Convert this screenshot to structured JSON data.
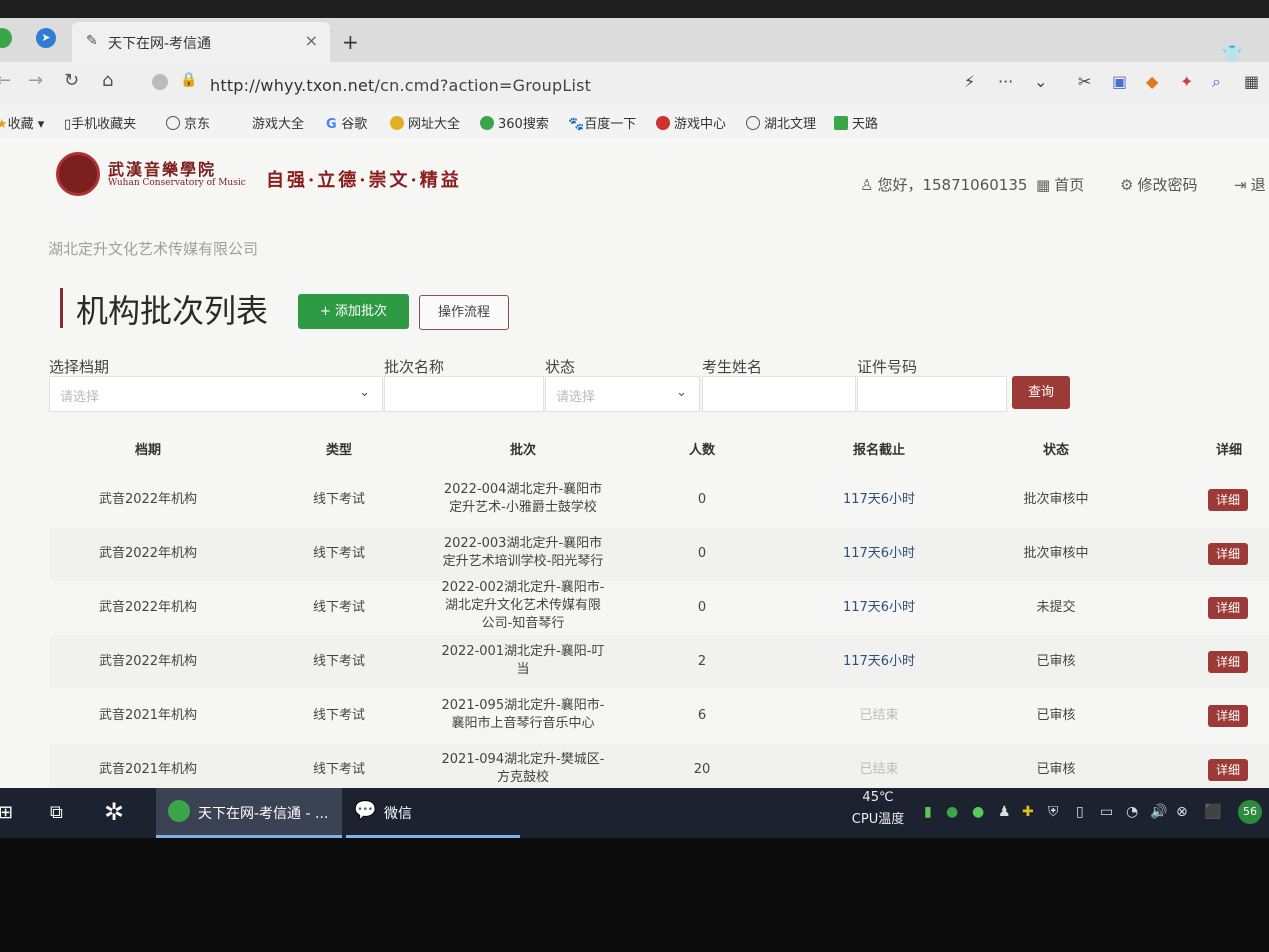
{
  "browser": {
    "tab_title": "天下在网-考信通",
    "tab_close": "×",
    "new_tab": "+",
    "url_host": "http://whyy.txon.net",
    "url_path": "/cn.cmd?action=GroupList",
    "bookmarks": [
      "收藏",
      "手机收藏夹",
      "京东",
      "游戏大全",
      "谷歌",
      "网址大全",
      "360搜索",
      "百度一下",
      "游戏中心",
      "湖北文理",
      "天路"
    ]
  },
  "header": {
    "logo_cn": "武漢音樂學院",
    "logo_en": "Wuhan Conservatory of Music",
    "motto": "自强·立德·崇文·精益",
    "greeting": "您好，15871060135",
    "home": "首页",
    "change_password": "修改密码",
    "logout": "退"
  },
  "page": {
    "company": "湖北定升文化艺术传媒有限公司",
    "title": "机构批次列表",
    "add_button": "+ 添加批次",
    "flow_button": "操作流程"
  },
  "filters": {
    "period_label": "选择档期",
    "period_placeholder": "请选择",
    "batch_label": "批次名称",
    "status_label": "状态",
    "status_placeholder": "请选择",
    "student_label": "考生姓名",
    "id_label": "证件号码",
    "query_button": "查询"
  },
  "table": {
    "headers": [
      "档期",
      "类型",
      "批次",
      "人数",
      "报名截止",
      "状态",
      "详细"
    ],
    "rows": [
      {
        "period": "武音2022年机构",
        "type": "线下考试",
        "batch1": "2022-004湖北定升-襄阳市",
        "batch2": "定升艺术-小雅爵士鼓学校",
        "batch3": "",
        "count": "0",
        "due": "117天6小时",
        "status": "批次审核中",
        "detail": "详细"
      },
      {
        "period": "武音2022年机构",
        "type": "线下考试",
        "batch1": "2022-003湖北定升-襄阳市",
        "batch2": "定升艺术培训学校-阳光琴行",
        "batch3": "",
        "count": "0",
        "due": "117天6小时",
        "status": "批次审核中",
        "detail": "详细"
      },
      {
        "period": "武音2022年机构",
        "type": "线下考试",
        "batch1": "2022-002湖北定升-襄阳市-",
        "batch2": "湖北定升文化艺术传媒有限",
        "batch3": "公司-知音琴行",
        "count": "0",
        "due": "117天6小时",
        "status": "未提交",
        "detail": "详细"
      },
      {
        "period": "武音2022年机构",
        "type": "线下考试",
        "batch1": "2022-001湖北定升-襄阳-叮",
        "batch2": "当",
        "batch3": "",
        "count": "2",
        "due": "117天6小时",
        "status": "已审核",
        "detail": "详细"
      },
      {
        "period": "武音2021年机构",
        "type": "线下考试",
        "batch1": "2021-095湖北定升-襄阳市-",
        "batch2": "襄阳市上音琴行音乐中心",
        "batch3": "",
        "count": "6",
        "due": "已结束",
        "status": "已审核",
        "detail": "详细"
      },
      {
        "period": "武音2021年机构",
        "type": "线下考试",
        "batch1": "2021-094湖北定升-樊城区-",
        "batch2": "方克鼓校",
        "batch3": "",
        "count": "20",
        "due": "已结束",
        "status": "已审核",
        "detail": "详细"
      }
    ]
  },
  "taskbar": {
    "app_browser": "天下在网-考信通 - ...",
    "app_wechat": "微信",
    "temp": "45℃",
    "temp_label": "CPU温度",
    "badge": "56"
  }
}
